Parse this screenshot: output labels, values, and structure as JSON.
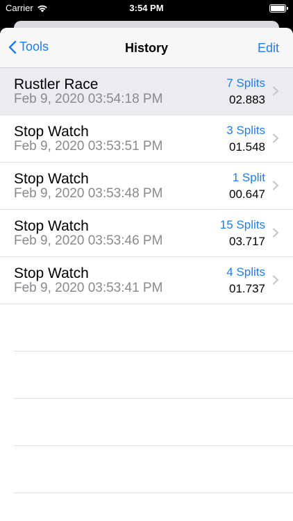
{
  "status_bar": {
    "carrier": "Carrier",
    "time": "3:54 PM"
  },
  "nav": {
    "back_label": "Tools",
    "title": "History",
    "edit_label": "Edit"
  },
  "rows": [
    {
      "title": "Rustler Race",
      "date": "Feb 9, 2020 03:54:18 PM",
      "splits": "7 Splits",
      "time": "02.883",
      "selected": true
    },
    {
      "title": "Stop Watch",
      "date": "Feb 9, 2020 03:53:51 PM",
      "splits": "3 Splits",
      "time": "01.548",
      "selected": false
    },
    {
      "title": "Stop Watch",
      "date": "Feb 9, 2020 03:53:48 PM",
      "splits": "1 Split",
      "time": "00.647",
      "selected": false
    },
    {
      "title": "Stop Watch",
      "date": "Feb 9, 2020 03:53:46 PM",
      "splits": "15 Splits",
      "time": "03.717",
      "selected": false
    },
    {
      "title": "Stop Watch",
      "date": "Feb 9, 2020 03:53:41 PM",
      "splits": "4 Splits",
      "time": "01.737",
      "selected": false
    }
  ],
  "colors": {
    "accent": "#1e7cf2",
    "secondary_text": "#8a8a8e",
    "selected_row": "#ebebf0"
  }
}
